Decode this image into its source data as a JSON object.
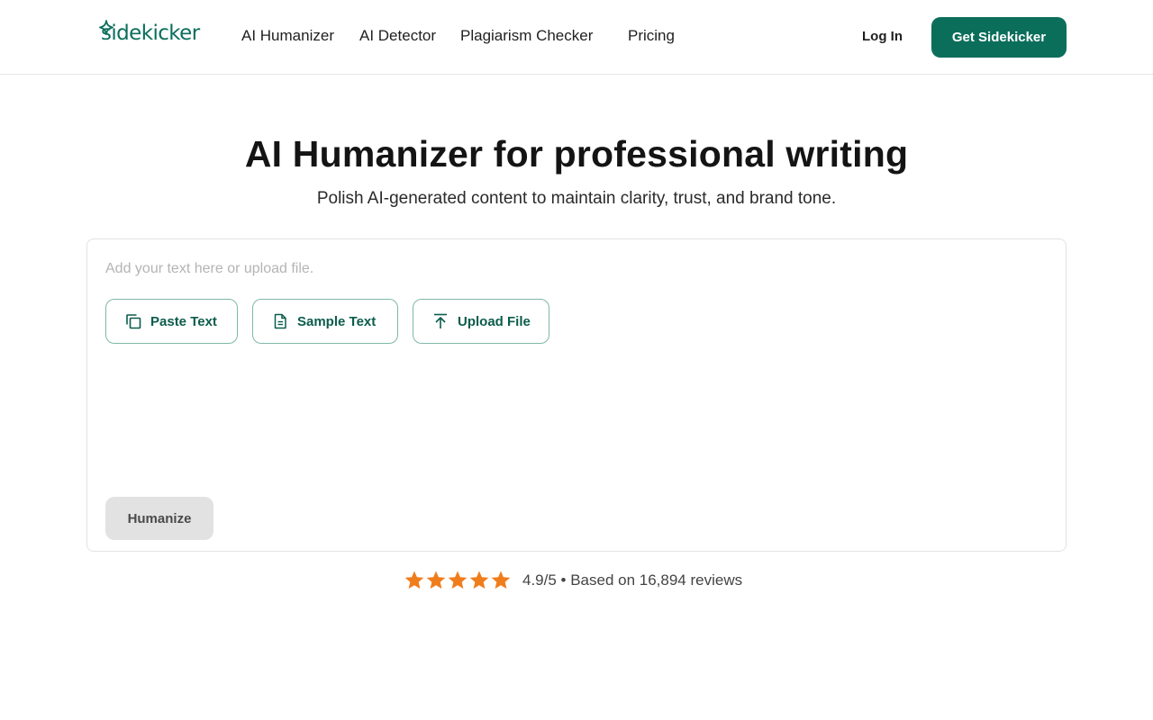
{
  "header": {
    "logo": "sidekicker",
    "nav": [
      "AI Humanizer",
      "AI Detector",
      "Plagiarism Checker",
      "Pricing"
    ],
    "login": "Log In",
    "cta": "Get Sidekicker"
  },
  "hero": {
    "title": "AI Humanizer for professional writing",
    "subtitle": "Polish AI-generated content to maintain clarity, trust, and brand tone."
  },
  "editor": {
    "placeholder": "Add your text here or upload file.",
    "buttons": {
      "paste": "Paste Text",
      "sample": "Sample Text",
      "upload": "Upload File"
    },
    "humanize": "Humanize"
  },
  "rating": {
    "stars": 5,
    "text": "4.9/5 • Based on 16,894 reviews"
  },
  "colors": {
    "brand": "#0b6e5b",
    "star": "#f07d1c",
    "border": "#e3e3e3"
  },
  "icons": [
    "sparkle-icon",
    "copy-icon",
    "document-icon",
    "upload-icon",
    "star-icon"
  ]
}
